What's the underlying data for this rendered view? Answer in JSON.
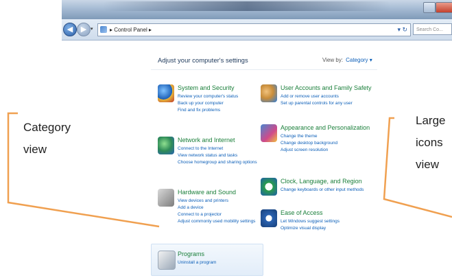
{
  "window": {
    "address_path": "Control Panel",
    "search_placeholder": "Search Co...",
    "heading": "Adjust your computer's settings",
    "view_by_label": "View by:",
    "view_by_value": "Category ▾"
  },
  "categories": [
    {
      "id": "system-security",
      "icon": "shield-icon",
      "title": "System and Security",
      "links": [
        "Review your computer's status",
        "Back up your computer",
        "Find and fix problems"
      ]
    },
    {
      "id": "network-internet",
      "icon": "globe-network-icon",
      "title": "Network and Internet",
      "links": [
        "Connect to the Internet",
        "View network status and tasks",
        "Choose homegroup and sharing options"
      ]
    },
    {
      "id": "hardware-sound",
      "icon": "printer-speaker-icon",
      "title": "Hardware and Sound",
      "links": [
        "View devices and printers",
        "Add a device",
        "Connect to a projector",
        "Adjust commonly used mobility settings"
      ]
    },
    {
      "id": "programs",
      "icon": "programs-icon",
      "title": "Programs",
      "links": [
        "Uninstall a program"
      ]
    },
    {
      "id": "user-accounts",
      "icon": "users-icon",
      "title": "User Accounts and Family Safety",
      "links": [
        "Add or remove user accounts",
        "Set up parental controls for any user"
      ]
    },
    {
      "id": "appearance",
      "icon": "appearance-icon",
      "title": "Appearance and Personalization",
      "links": [
        "Change the theme",
        "Change desktop background",
        "Adjust screen resolution"
      ]
    },
    {
      "id": "clock-language",
      "icon": "clock-globe-icon",
      "title": "Clock, Language, and Region",
      "links": [
        "Change keyboards or other input methods"
      ]
    },
    {
      "id": "ease-access",
      "icon": "ease-of-access-icon",
      "title": "Ease of Access",
      "links": [
        "Let Windows suggest settings",
        "Optimize visual display"
      ]
    }
  ],
  "callouts": {
    "left": [
      "Category",
      "view"
    ],
    "right": [
      "Large",
      "icons",
      "view"
    ]
  },
  "colors": {
    "callout_line": "#f0a050",
    "category_title": "#1a7f3a",
    "link": "#0b5eb8"
  }
}
